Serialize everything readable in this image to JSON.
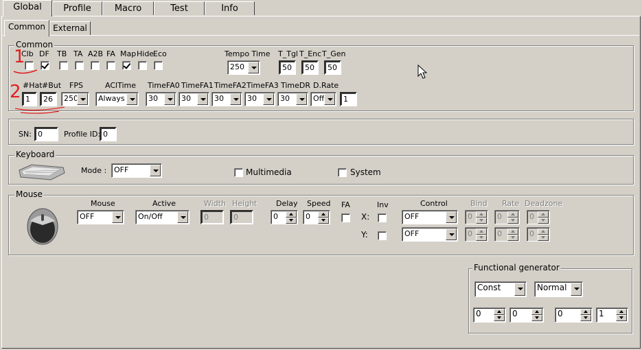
{
  "tabs": [
    "Global",
    "Profile",
    "Macro",
    "Test",
    "Info"
  ],
  "subtabs": [
    "Common",
    "External"
  ],
  "common": {
    "title": "Common",
    "flags": [
      {
        "label": "Clb",
        "checked": false
      },
      {
        "label": "DF",
        "checked": true
      },
      {
        "label": "TB",
        "checked": false
      },
      {
        "label": "TA",
        "checked": false
      },
      {
        "label": "A2B",
        "checked": false
      },
      {
        "label": "FA",
        "checked": false
      },
      {
        "label": "Map",
        "checked": true
      },
      {
        "label": "Hide",
        "checked": false
      },
      {
        "label": "Eco",
        "checked": false
      }
    ],
    "tempo_time_label": "Tempo Time",
    "tempo_time": "250",
    "t_tgl_label": "T_Tgl",
    "t_tgl": "50",
    "t_enc_label": "T_Enc",
    "t_enc": "50",
    "t_gen_label": "T_Gen",
    "t_gen": "50",
    "hat_label": "#Hat",
    "hat": "1",
    "but_label": "#But",
    "but": "26",
    "fps_label": "FPS",
    "fps": "250",
    "acltime_label": "AClTime",
    "acltime": "Always",
    "timefa0_label": "TimeFA0",
    "timefa0": "30",
    "timefa1_label": "TimeFA1",
    "timefa1": "30",
    "timefa2_label": "TimeFA2",
    "timefa2": "30",
    "timefa3_label": "TimeFA3",
    "timefa3": "30",
    "timedr_label": "TimeDR",
    "timedr": "30",
    "drate_label": "D.Rate",
    "drate": "Off",
    "drate_value": "1"
  },
  "sn": {
    "label": "SN:",
    "value": "0",
    "profile_label": "Profile ID:",
    "profile_value": "0"
  },
  "keyboard": {
    "title": "Keyboard",
    "mode_label": "Mode :",
    "mode": "OFF",
    "multimedia": "Multimedia",
    "system": "System"
  },
  "mouse": {
    "title": "Mouse",
    "mouse_label": "Mouse",
    "mouse_value": "OFF",
    "active_label": "Active",
    "active_value": "On/Off",
    "width_label": "Width",
    "width_value": "0",
    "height_label": "Height",
    "height_value": "0",
    "delay_label": "Delay",
    "delay_value": "0",
    "speed_label": "Speed",
    "speed_value": "0",
    "fa_label": "FA",
    "inv_label": "Inv",
    "x_label": "X:",
    "y_label": "Y:",
    "control_label": "Control",
    "control_x": "OFF",
    "control_y": "OFF",
    "bind_label": "Bind",
    "rate_label": "Rate",
    "deadzone_label": "Deadzone",
    "zero": "0"
  },
  "fg": {
    "title": "Functional generator",
    "type": "Const",
    "mode": "Normal",
    "v1": "0",
    "v2": "0",
    "v3": "0",
    "v4": "1"
  },
  "annotations": {
    "one": "1",
    "two": "2"
  }
}
